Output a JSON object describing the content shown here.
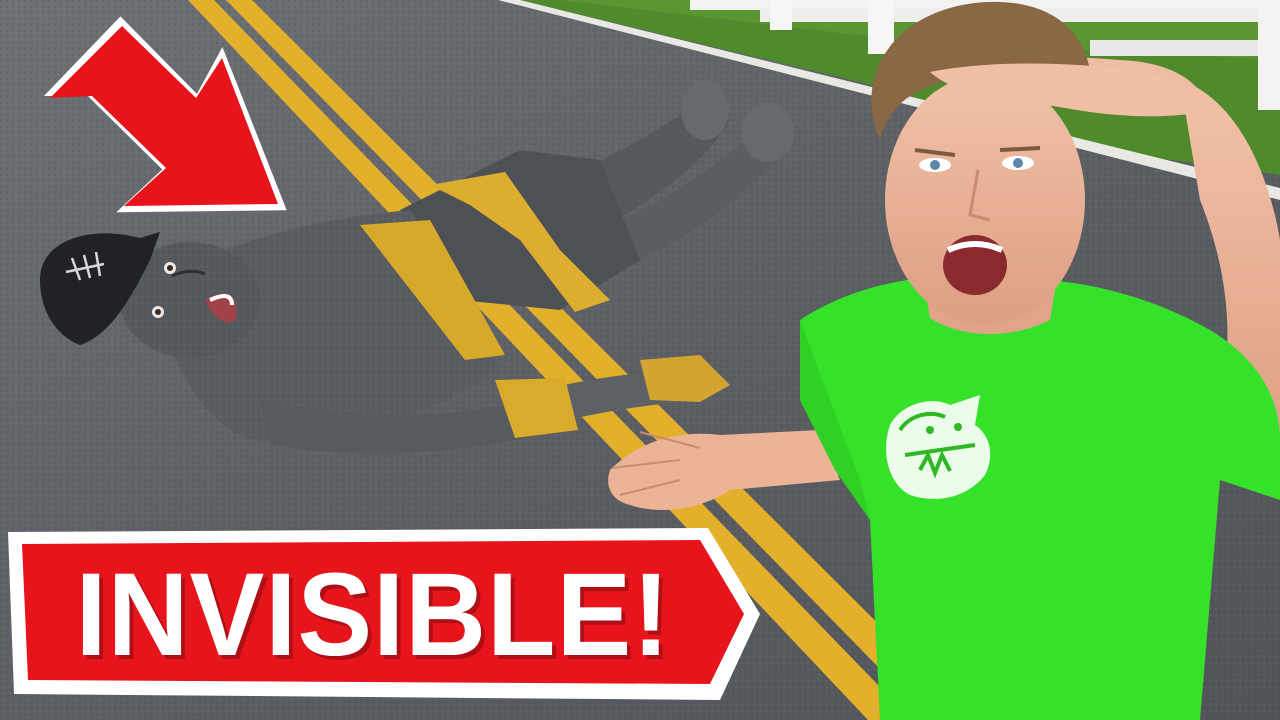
{
  "thumbnail": {
    "banner_text": "INVISIBLE!",
    "arrow_icon": "red-arrow-down-right",
    "colors": {
      "banner_red": "#e8141c",
      "shirt_green": "#36e12a",
      "road_line_yellow": "#e7b52e",
      "asphalt": "#5f6266"
    }
  }
}
